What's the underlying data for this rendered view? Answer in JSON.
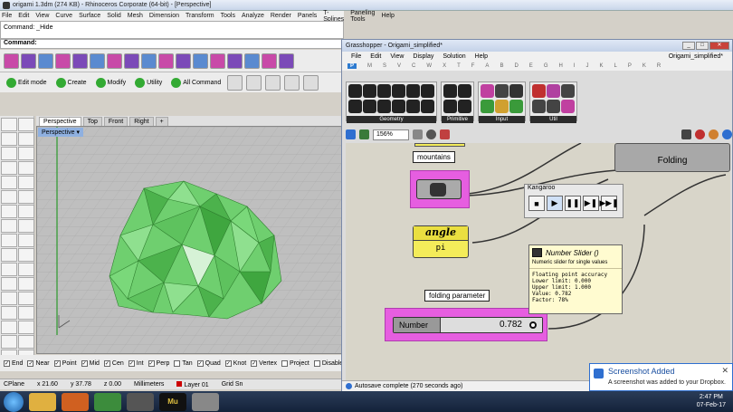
{
  "rhino": {
    "title": "origami 1.3dm (274 KB) - Rhinoceros Corporate (64-bit) - [Perspective]",
    "menu": [
      "File",
      "Edit",
      "View",
      "Curve",
      "Surface",
      "Solid",
      "Mesh",
      "Dimension",
      "Transform",
      "Tools",
      "Analyze",
      "Render",
      "Panels",
      "T-Splines",
      "Paneling Tools",
      "Help"
    ],
    "command_history": "Command: _Hide",
    "command_prompt": "Command:",
    "toolbar2": [
      "Edit mode",
      "Create",
      "Modify",
      "Utility",
      "All Command"
    ],
    "viewport_tabs": [
      "Perspective",
      "Top",
      "Front",
      "Right"
    ],
    "viewport_label": "Perspective",
    "osnaps": [
      "End",
      "Near",
      "Point",
      "Mid",
      "Cen",
      "Int",
      "Perp",
      "Tan",
      "Quad",
      "Knot",
      "Vertex",
      "Project",
      "Disable"
    ],
    "status": {
      "cplane": "CPlane",
      "x": "x 21.60",
      "y": "y 37.78",
      "z": "z 0.00",
      "units": "Millimeters",
      "layer": "Layer 01",
      "grid": "Grid Sn"
    }
  },
  "grasshopper": {
    "title": "Grasshopper - Origami_simplified*",
    "menu": [
      "File",
      "Edit",
      "View",
      "Display",
      "Solution",
      "Help"
    ],
    "doc_name": "Origami_simplified*",
    "categories": [
      "P",
      "M",
      "S",
      "V",
      "C",
      "W",
      "X",
      "T",
      "F",
      "A",
      "B",
      "D",
      "E",
      "G",
      "H",
      "I",
      "J",
      "K",
      "L",
      "P",
      "K",
      "R"
    ],
    "ribbon_groups": [
      "Geometry",
      "Primitive",
      "Input",
      "Util"
    ],
    "zoom": "156%",
    "status": "Autosave complete (270 seconds ago)",
    "canvas": {
      "mountains_label": "mountains",
      "folding_label": "Folding",
      "angle_label": "angle",
      "angle_value": "pi",
      "folding_param_label": "folding parameter",
      "slider_name": "Number",
      "slider_value": "0.782",
      "slider_fraction": 0.782
    },
    "kangaroo": {
      "title": "Kangaroo",
      "buttons": [
        "■",
        "▶",
        "❚❚",
        "▶❚",
        "▶▶❚"
      ]
    },
    "tooltip": {
      "title": "Number Slider ()",
      "description": "Numeric slider for single values",
      "info": [
        "Floating point accuracy",
        "Lower limit: 0.000",
        "Upper limit: 1.000",
        "Value: 0.782",
        "Factor: 78%"
      ]
    }
  },
  "notification": {
    "title": "Screenshot Added",
    "text": "A screenshot was added to your Dropbox."
  },
  "taskbar": {
    "time": "2:47 PM",
    "date": "07-Feb-17",
    "app_label_mu": "Mu"
  },
  "colors": {
    "mesh_green": "#5cc45c",
    "node_pink": "#e65ee0",
    "angle_yellow": "#f4ec5a"
  }
}
